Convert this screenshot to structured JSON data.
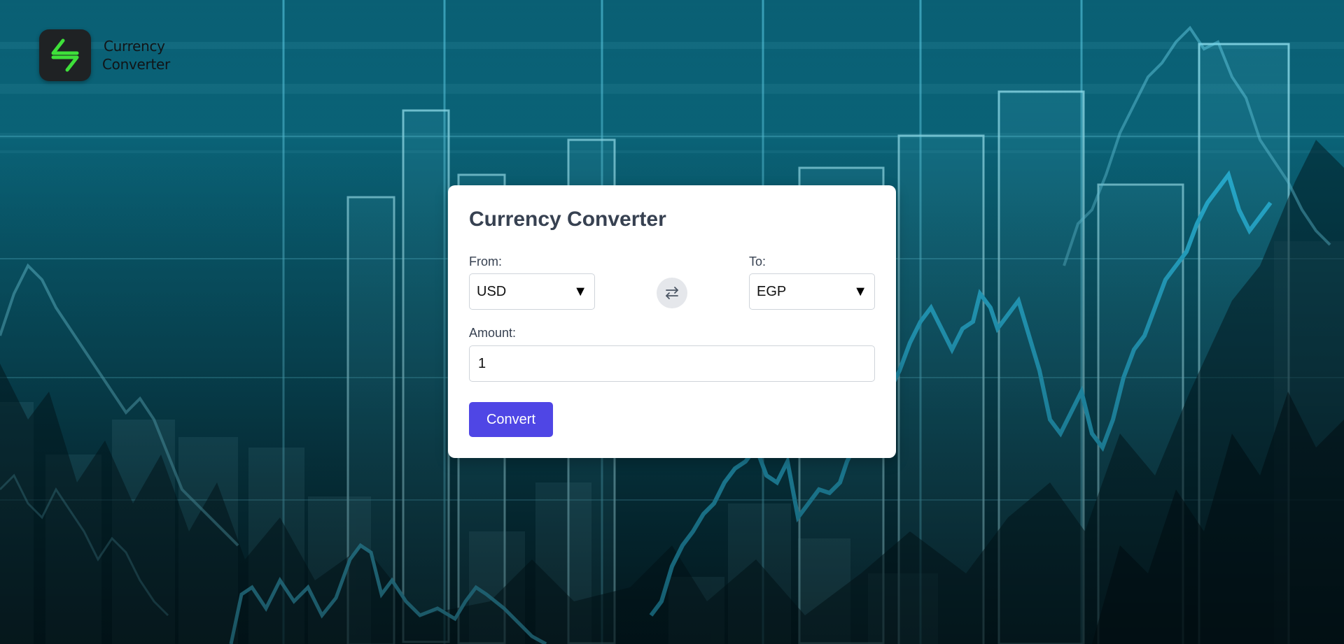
{
  "app": {
    "logo_line1": "Currency",
    "logo_line2": "Converter",
    "logo_icon": "lightning-transfer-icon"
  },
  "converter": {
    "title": "Currency Converter",
    "from_label": "From:",
    "from_value": "USD",
    "to_label": "To:",
    "to_value": "EGP",
    "swap_icon": "swap-arrows-icon",
    "amount_label": "Amount:",
    "amount_value": "1",
    "convert_label": "Convert"
  },
  "colors": {
    "accent": "#4f46e5",
    "background": "#0a6478",
    "logo_green": "#39e639"
  }
}
